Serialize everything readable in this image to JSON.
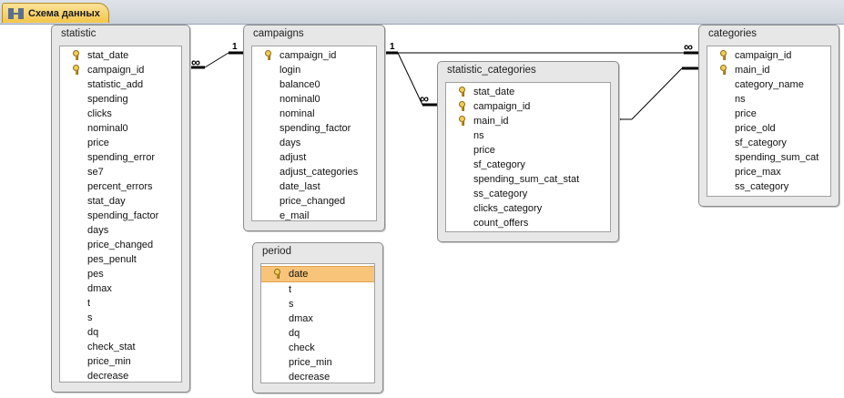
{
  "tab": {
    "title": "Схема данных",
    "icon": "relationships-icon"
  },
  "cardinality": {
    "one": "1",
    "many": "∞"
  },
  "tables": {
    "statistic": {
      "title": "statistic",
      "fields": [
        {
          "name": "stat_date",
          "key": true
        },
        {
          "name": "campaign_id",
          "key": true
        },
        {
          "name": "statistic_add"
        },
        {
          "name": "spending"
        },
        {
          "name": "clicks"
        },
        {
          "name": "nominal0"
        },
        {
          "name": "price"
        },
        {
          "name": "spending_error"
        },
        {
          "name": "se7"
        },
        {
          "name": "percent_errors"
        },
        {
          "name": "stat_day"
        },
        {
          "name": "spending_factor"
        },
        {
          "name": "days"
        },
        {
          "name": "price_changed"
        },
        {
          "name": "pes_penult"
        },
        {
          "name": "pes"
        },
        {
          "name": "dmax"
        },
        {
          "name": "t"
        },
        {
          "name": "s"
        },
        {
          "name": "dq"
        },
        {
          "name": "check_stat"
        },
        {
          "name": "price_min"
        },
        {
          "name": "decrease"
        }
      ]
    },
    "campaigns": {
      "title": "campaigns",
      "fields": [
        {
          "name": "campaign_id",
          "key": true
        },
        {
          "name": "login"
        },
        {
          "name": "balance0"
        },
        {
          "name": "nominal0"
        },
        {
          "name": "nominal"
        },
        {
          "name": "spending_factor"
        },
        {
          "name": "days"
        },
        {
          "name": "adjust"
        },
        {
          "name": "adjust_categories"
        },
        {
          "name": "date_last"
        },
        {
          "name": "price_changed"
        },
        {
          "name": "e_mail"
        }
      ]
    },
    "statistic_categories": {
      "title": "statistic_categories",
      "fields": [
        {
          "name": "stat_date",
          "key": true
        },
        {
          "name": "campaign_id",
          "key": true
        },
        {
          "name": "main_id",
          "key": true
        },
        {
          "name": "ns"
        },
        {
          "name": "price"
        },
        {
          "name": "sf_category"
        },
        {
          "name": "spending_sum_cat_stat"
        },
        {
          "name": "ss_category"
        },
        {
          "name": "clicks_category"
        },
        {
          "name": "count_offers"
        }
      ]
    },
    "categories": {
      "title": "categories",
      "fields": [
        {
          "name": "campaign_id",
          "key": true
        },
        {
          "name": "main_id",
          "key": true
        },
        {
          "name": "category_name"
        },
        {
          "name": "ns"
        },
        {
          "name": "price"
        },
        {
          "name": "price_old"
        },
        {
          "name": "sf_category"
        },
        {
          "name": "spending_sum_cat"
        },
        {
          "name": "price_max"
        },
        {
          "name": "ss_category"
        }
      ]
    },
    "period": {
      "title": "period",
      "fields": [
        {
          "name": "date",
          "key": true,
          "selected": true
        },
        {
          "name": "t"
        },
        {
          "name": "s"
        },
        {
          "name": "dmax"
        },
        {
          "name": "dq"
        },
        {
          "name": "check"
        },
        {
          "name": "price_min"
        },
        {
          "name": "decrease"
        }
      ]
    }
  }
}
